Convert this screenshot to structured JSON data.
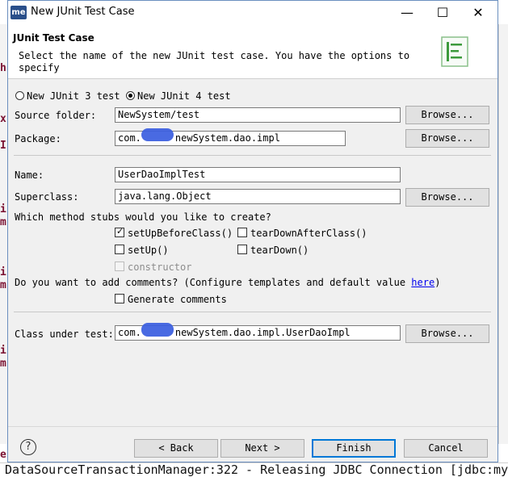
{
  "window": {
    "app_icon": "me",
    "title": "New JUnit Test Case",
    "minimize": "—",
    "maximize": "☐",
    "close": "✕"
  },
  "header": {
    "title": "JUnit Test Case",
    "description": "Select the name of the new JUnit test case. You have the options to specify"
  },
  "junit_version": {
    "junit3_label": "New JUnit 3 test",
    "junit4_label": "New JUnit 4 test",
    "selected": "junit4"
  },
  "source_folder": {
    "label": "Source folder:",
    "value": "NewSystem/test",
    "browse": "Browse..."
  },
  "package": {
    "label": "Package:",
    "value_prefix": "com.",
    "value_suffix": "newSystem.dao.impl",
    "browse": "Browse..."
  },
  "name": {
    "label": "Name:",
    "value": "UserDaoImplTest"
  },
  "superclass": {
    "label": "Superclass:",
    "value": "java.lang.Object",
    "browse": "Browse..."
  },
  "stubs": {
    "question": "Which method stubs would you like to create?",
    "setUpBeforeClass": "setUpBeforeClass()",
    "tearDownAfterClass": "tearDownAfterClass()",
    "setUp": "setUp()",
    "tearDown": "tearDown()",
    "constructor": "constructor",
    "check_mark": "✓"
  },
  "comments": {
    "question": "Do you want to add comments? (Configure templates and default value ",
    "link": "here",
    "close_paren": ")",
    "generate": "Generate comments"
  },
  "class_under_test": {
    "label": "Class under test:",
    "value_prefix": "com.",
    "value_suffix": "newSystem.dao.impl.UserDaoImpl",
    "browse": "Browse..."
  },
  "footer": {
    "help": "?",
    "back": "< Back",
    "next": "Next >",
    "finish": "Finish",
    "cancel": "Cancel"
  },
  "background": {
    "log_line": "DataSourceTransactionManager:322 - Releasing JDBC Connection [jdbc:my",
    "left_chars": [
      "h",
      "x",
      "I",
      "i",
      "m",
      "i",
      "m",
      "i",
      "m",
      "e"
    ]
  }
}
